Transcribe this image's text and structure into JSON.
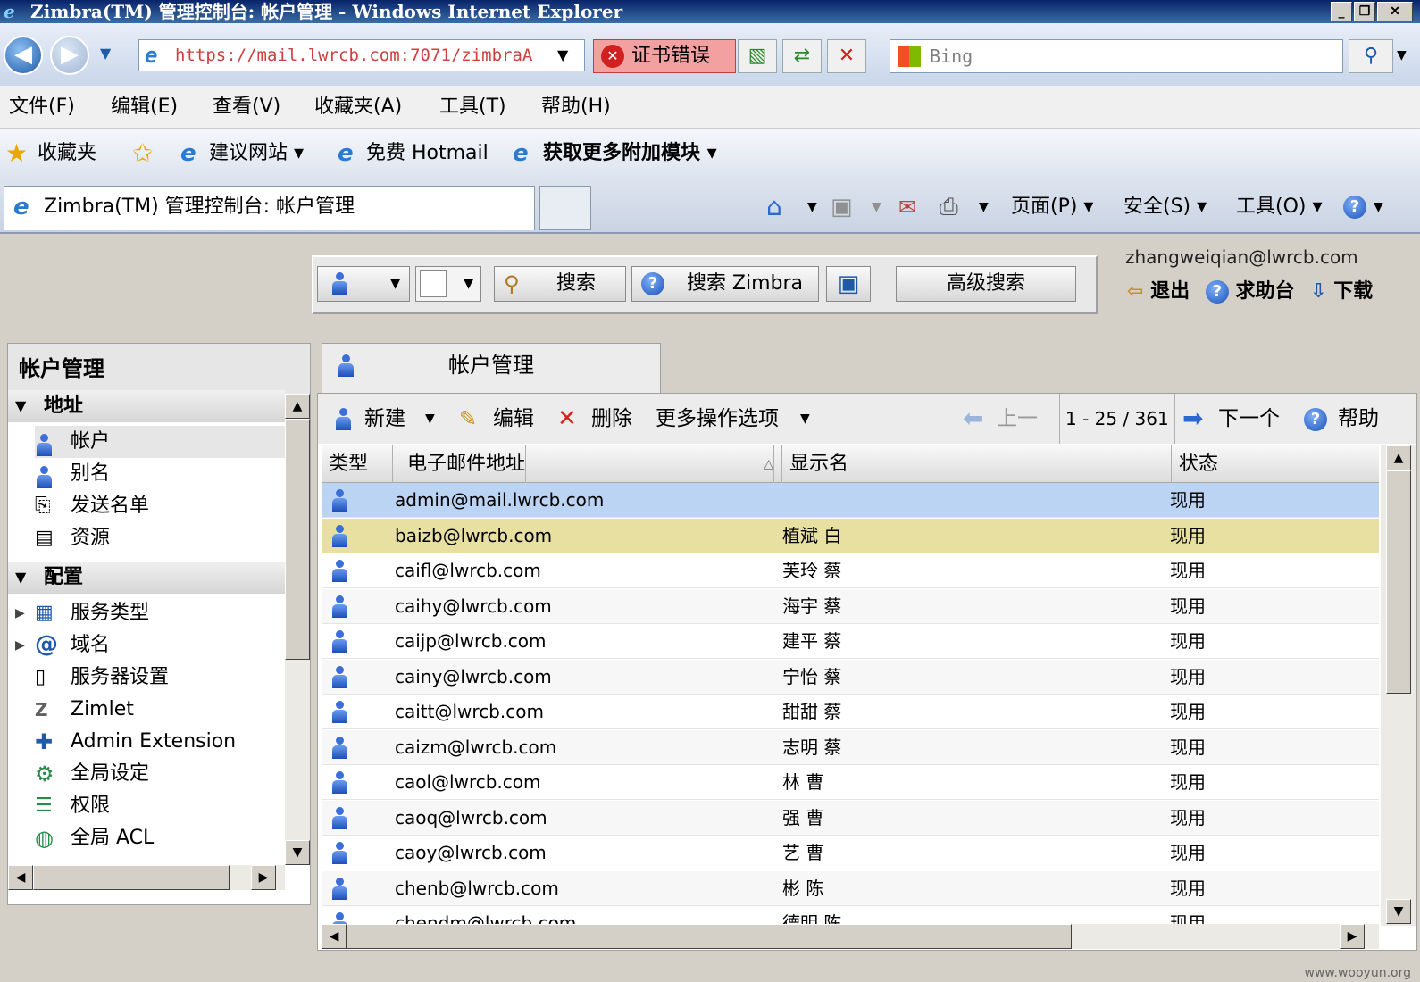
{
  "window": {
    "title": "Zimbra(TM) 管理控制台: 帐户管理 - Windows Internet Explorer",
    "min": "_",
    "max": "❐",
    "close": "✕"
  },
  "address_bar": {
    "url": "https://mail.lwrcb.com:7071/zimbraA",
    "cert_error": "证书错误",
    "search_placeholder": "Bing"
  },
  "menu": [
    "文件(F)",
    "编辑(E)",
    "查看(V)",
    "收藏夹(A)",
    "工具(T)",
    "帮助(H)"
  ],
  "favorites": {
    "label": "收藏夹",
    "items": [
      "建议网站 ▾",
      "免费 Hotmail",
      "获取更多附加模块 ▾"
    ]
  },
  "ie_tab": {
    "title": "Zimbra(TM) 管理控制台: 帐户管理"
  },
  "command_bar": [
    "页面(P) ▾",
    "安全(S) ▾",
    "工具(O) ▾"
  ],
  "zimbra_toolbar": {
    "search": "搜索",
    "search_zimbra": "搜索 Zimbra",
    "advanced_search": "高级搜索"
  },
  "user": {
    "email": "zhangweiqian@lwrcb.com",
    "logout": "退出",
    "help_desk": "求助台",
    "download": "下载"
  },
  "left_panel": {
    "title": "帐户管理",
    "sections": [
      {
        "label": "地址",
        "items": [
          "帐户",
          "别名",
          "发送名单",
          "资源"
        ]
      },
      {
        "label": "配置",
        "items": [
          "服务类型",
          "域名",
          "服务器设置",
          "Zimlet",
          "Admin Extension",
          "全局设定",
          "权限",
          "全局 ACL"
        ]
      }
    ]
  },
  "main": {
    "tab_label": "帐户管理",
    "actions": {
      "new": "新建",
      "edit": "编辑",
      "delete": "删除",
      "more": "更多操作选项",
      "prev": "上一",
      "page_info": "1 - 25 / 361",
      "next": "下一个",
      "help": "帮助"
    },
    "columns": [
      "类型",
      "电子邮件地址",
      "显示名",
      "状态"
    ],
    "rows": [
      {
        "email": "admin@mail.lwrcb.com",
        "name": "",
        "status": "现用"
      },
      {
        "email": "baizb@lwrcb.com",
        "name": "植斌 白",
        "status": "现用"
      },
      {
        "email": "caifl@lwrcb.com",
        "name": "芙玲 蔡",
        "status": "现用"
      },
      {
        "email": "caihy@lwrcb.com",
        "name": "海宇 蔡",
        "status": "现用"
      },
      {
        "email": "caijp@lwrcb.com",
        "name": "建平 蔡",
        "status": "现用"
      },
      {
        "email": "cainy@lwrcb.com",
        "name": "宁怡 蔡",
        "status": "现用"
      },
      {
        "email": "caitt@lwrcb.com",
        "name": "甜甜 蔡",
        "status": "现用"
      },
      {
        "email": "caizm@lwrcb.com",
        "name": "志明 蔡",
        "status": "现用"
      },
      {
        "email": "caol@lwrcb.com",
        "name": "林 曹",
        "status": "现用"
      },
      {
        "email": "caoq@lwrcb.com",
        "name": "强 曹",
        "status": "现用"
      },
      {
        "email": "caoy@lwrcb.com",
        "name": "艺 曹",
        "status": "现用"
      },
      {
        "email": "chenb@lwrcb.com",
        "name": "彬 陈",
        "status": "现用"
      },
      {
        "email": "chendm@lwrcb.com",
        "name": "德明 陈",
        "status": "现用"
      }
    ]
  },
  "watermark": "www.wooyun.org",
  "colors": {
    "selected_row": "#bcd4f4",
    "hover_row": "#e8e0a0",
    "title_bar": "#0a246a"
  }
}
